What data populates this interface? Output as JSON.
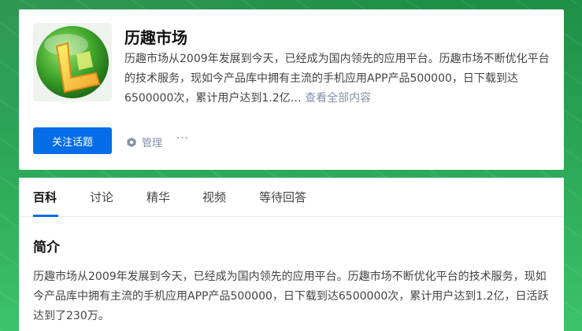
{
  "topic": {
    "title": "历趣市场",
    "description": "历趣市场从2009年发展到今天，已经成为国内领先的应用平台。历趣市场不断优化平台的技术服务，现如今产品库中拥有主流的手机应用APP产品500000，日下载到达6500000次，累计用户达到1.2亿…",
    "more_link": "查看全部内容"
  },
  "actions": {
    "follow_label": "关注话题",
    "manage_label": "管理",
    "more_label": "···"
  },
  "tabs": [
    {
      "label": "百科",
      "active": true
    },
    {
      "label": "讨论",
      "active": false
    },
    {
      "label": "精华",
      "active": false
    },
    {
      "label": "视频",
      "active": false
    },
    {
      "label": "等待回答",
      "active": false
    }
  ],
  "intro": {
    "heading": "简介",
    "text": "历趣市场从2009年发展到今天，已经成为国内领先的应用平台。历趣市场不断优化平台的技术服务，现如今产品库中拥有主流的手机应用APP产品500000，日下载到达6500000次，累计用户达到1.2亿，日活跃达到了230万。"
  },
  "colors": {
    "accent": "#056de8",
    "background": "#2a9a4f"
  },
  "icons": {
    "logo": "lequ-logo",
    "manage": "hexagon-gear-icon"
  }
}
